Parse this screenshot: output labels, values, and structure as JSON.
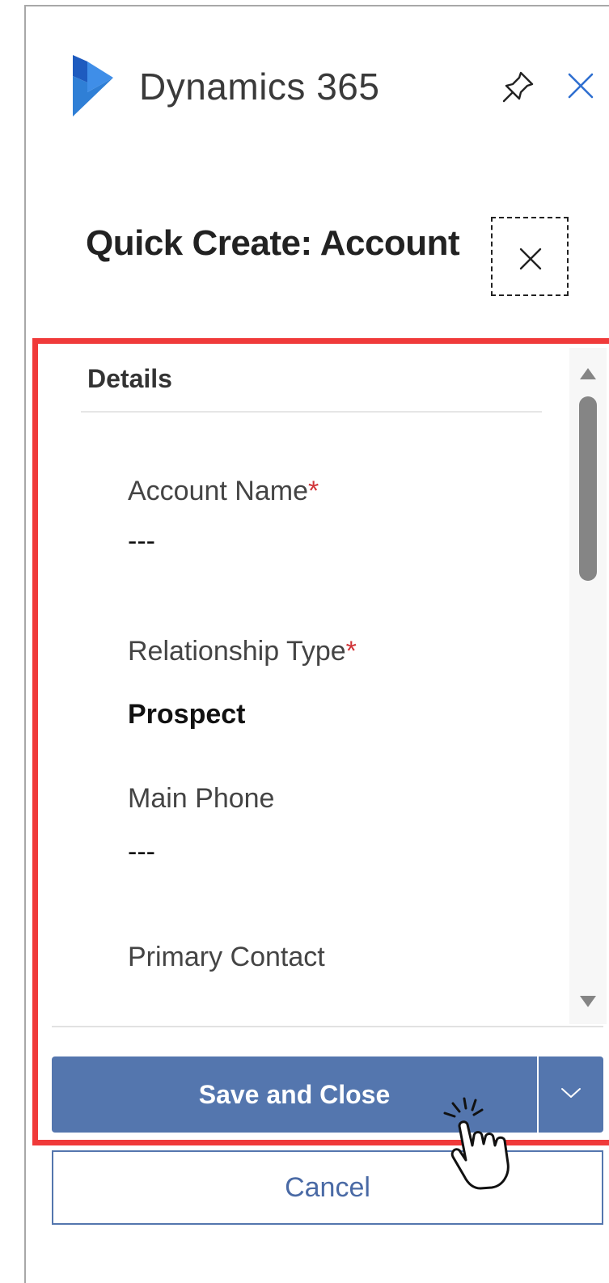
{
  "header": {
    "app_title": "Dynamics 365",
    "logo_icon": "dynamics-logo-icon",
    "pin_icon": "pin-icon",
    "close_icon": "close-icon"
  },
  "dialog": {
    "title": "Quick Create: Account"
  },
  "form": {
    "section_title": "Details",
    "fields": [
      {
        "label": "Account Name",
        "required": "*",
        "value": "---"
      },
      {
        "label": "Relationship Type",
        "required": "*",
        "value": "Prospect"
      },
      {
        "label": "Main Phone",
        "required": "",
        "value": "---"
      },
      {
        "label": "Primary Contact",
        "required": ""
      }
    ]
  },
  "actions": {
    "save_label": "Save and Close",
    "cancel_label": "Cancel"
  },
  "colors": {
    "accent": "#5476ae",
    "highlight": "#f03a3a",
    "required": "#d13438",
    "logo": "#2f7fd6"
  }
}
